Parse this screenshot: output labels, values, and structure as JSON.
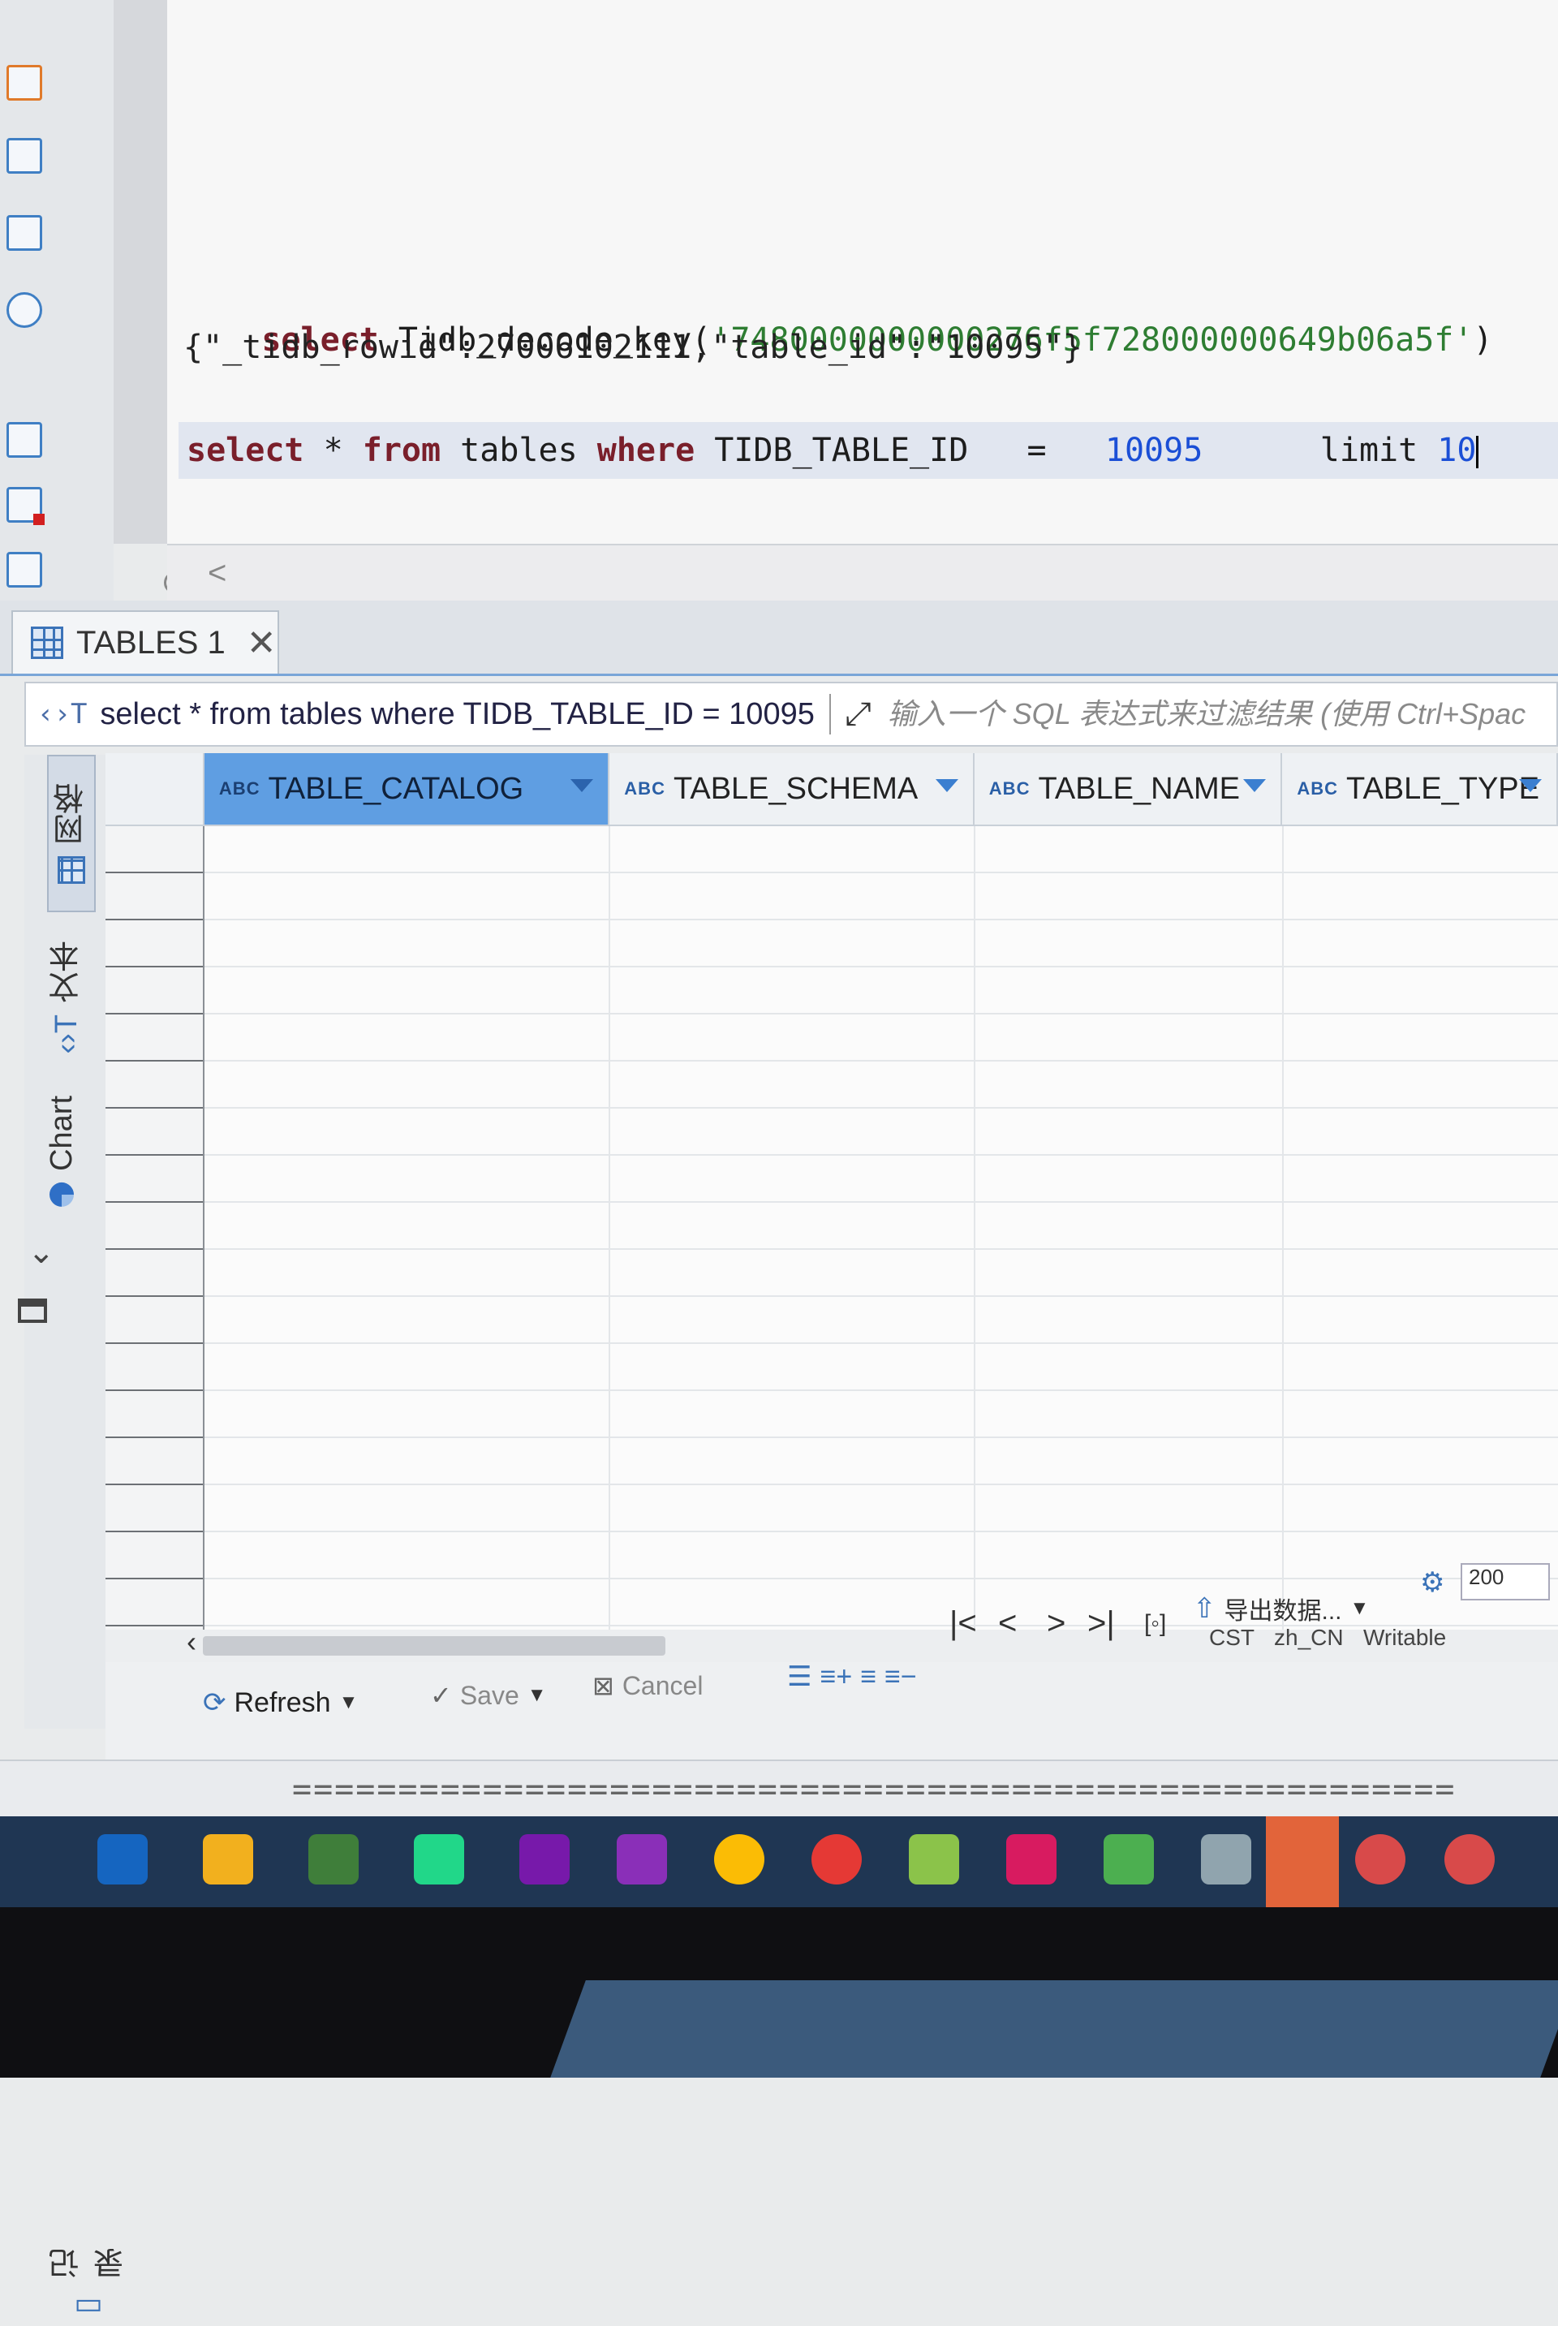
{
  "editor": {
    "line1_kw": "select",
    "line1_fn": "Tidb_decode_key(",
    "line1_str": "'7480000000000276f5f728000000649b06a5f'",
    "line1_end": ")",
    "line2": "{\"_tidb_rowid\":27006102111,\"table_id\":\"10095\"}",
    "line3_kw1": "select",
    "line3_star": " * ",
    "line3_kw2": "from",
    "line3_table": " tables ",
    "line3_kw3": "where",
    "line3_col": " TIDB_TABLE_ID   =   ",
    "line3_num": "10095",
    "line3_limit": "      limit ",
    "line3_limitnum": "10"
  },
  "results_tab": {
    "label": "TABLES 1"
  },
  "filter_bar": {
    "query": "select * from tables where TIDB_TABLE_ID = 10095",
    "placeholder": "输入一个 SQL 表达式来过滤结果 (使用 Ctrl+Spac"
  },
  "side_tabs": {
    "grid": "网格",
    "text": "文本",
    "chart": "Chart",
    "record": "记录"
  },
  "grid": {
    "type_badge": "ABC",
    "columns": [
      "TABLE_CATALOG",
      "TABLE_SCHEMA",
      "TABLE_NAME",
      "TABLE_TYPE"
    ],
    "rows": []
  },
  "toolbar": {
    "refresh": "Refresh",
    "save": "Save",
    "cancel": "Cancel",
    "export": "导出数据...",
    "fetch_size": "200",
    "timezone": "CST",
    "locale": "zh_CN",
    "mode": "Writable"
  },
  "console": {
    "separator": "======================================================="
  },
  "colors": {
    "selected_column": "#5f9ee2",
    "keyword": "#7a1f2b",
    "string": "#2e7d32",
    "number": "#1b4fd6",
    "taskbar": "#1f3653"
  }
}
